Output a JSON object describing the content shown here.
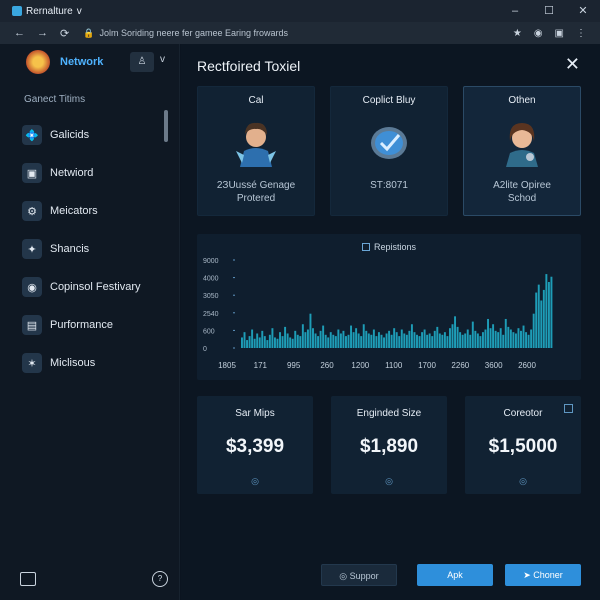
{
  "window": {
    "tab_title": "Rernalture",
    "tab_chevron": "v",
    "controls": [
      "–",
      "☐",
      "✕"
    ]
  },
  "browser": {
    "back": "←",
    "forward": "→",
    "reload": "⟳",
    "url": "Jolm Soriding neere fer gamee Earing frowards",
    "icons": [
      "star-icon",
      "info-icon",
      "extension-icon",
      "menu-icon"
    ]
  },
  "sidebar": {
    "brand": "Network",
    "section_title": "Ganect Titims",
    "items": [
      {
        "label": "Galicids",
        "icon": "💠"
      },
      {
        "label": "Netwiord",
        "icon": "▣"
      },
      {
        "label": "Meicators",
        "icon": "⚙"
      },
      {
        "label": "Shancis",
        "icon": "✦"
      },
      {
        "label": "Copinsol Festivary",
        "icon": "◉"
      },
      {
        "label": "Purformance",
        "icon": "▤"
      },
      {
        "label": "Miclisous",
        "icon": "✶"
      }
    ]
  },
  "main": {
    "title": "Rectfoired Toxiel",
    "cards": [
      {
        "title": "Cal",
        "subtitle_1": "2ЗUussé Genage",
        "subtitle_2": "Protered"
      },
      {
        "title": "Coplict Bluy",
        "subtitle_1": "SТ:8071",
        "subtitle_2": ""
      },
      {
        "title": "Othen",
        "subtitle_1": "A2lite Opiree",
        "subtitle_2": "Schod"
      }
    ],
    "stats": [
      {
        "label": "Sar Mips",
        "value": "$3,399"
      },
      {
        "label": "Enginded Size",
        "value": "$1,890"
      },
      {
        "label": "Coreotor",
        "value": "$1,5000"
      }
    ],
    "buttons": {
      "support": "Suppor",
      "apk": "Apk",
      "choner": "Choner"
    }
  },
  "chart_data": {
    "type": "bar",
    "title": "",
    "legend": "Repistions",
    "ylim": [
      0,
      9000
    ],
    "yticks": [
      "9000",
      "4000",
      "3050",
      "2540",
      "600",
      "0"
    ],
    "xticks": [
      "1805",
      "171",
      "995",
      "260",
      "1200",
      "1100",
      "1700",
      "2260",
      "3600",
      "2600"
    ],
    "values": [
      800,
      1200,
      600,
      900,
      1400,
      700,
      1100,
      800,
      1300,
      900,
      600,
      1000,
      1500,
      800,
      700,
      1200,
      900,
      1600,
      1100,
      800,
      700,
      1300,
      1000,
      900,
      1800,
      1200,
      1400,
      2600,
      1500,
      1100,
      900,
      1300,
      1700,
      1000,
      800,
      1200,
      1000,
      900,
      1400,
      1100,
      1300,
      900,
      1000,
      1700,
      1200,
      1500,
      1100,
      900,
      1800,
      1300,
      1100,
      1000,
      1400,
      900,
      1200,
      1000,
      800,
      1100,
      1300,
      1000,
      1500,
      1200,
      900,
      1400,
      1100,
      1000,
      1300,
      1800,
      1200,
      1000,
      900,
      1200,
      1400,
      1000,
      1100,
      900,
      1300,
      1600,
      1100,
      1000,
      1200,
      900,
      1500,
      1800,
      2400,
      1600,
      1200,
      1000,
      1100,
      1400,
      1000,
      2000,
      1300,
      1100,
      900,
      1200,
      1400,
      2200,
      1500,
      1800,
      1300,
      1200,
      1500,
      1000,
      2200,
      1600,
      1400,
      1200,
      1100,
      1500,
      1300,
      1700,
      1200,
      1000,
      1400,
      2600,
      4200,
      4800,
      3600,
      4400,
      5600,
      5000,
      5400
    ]
  }
}
